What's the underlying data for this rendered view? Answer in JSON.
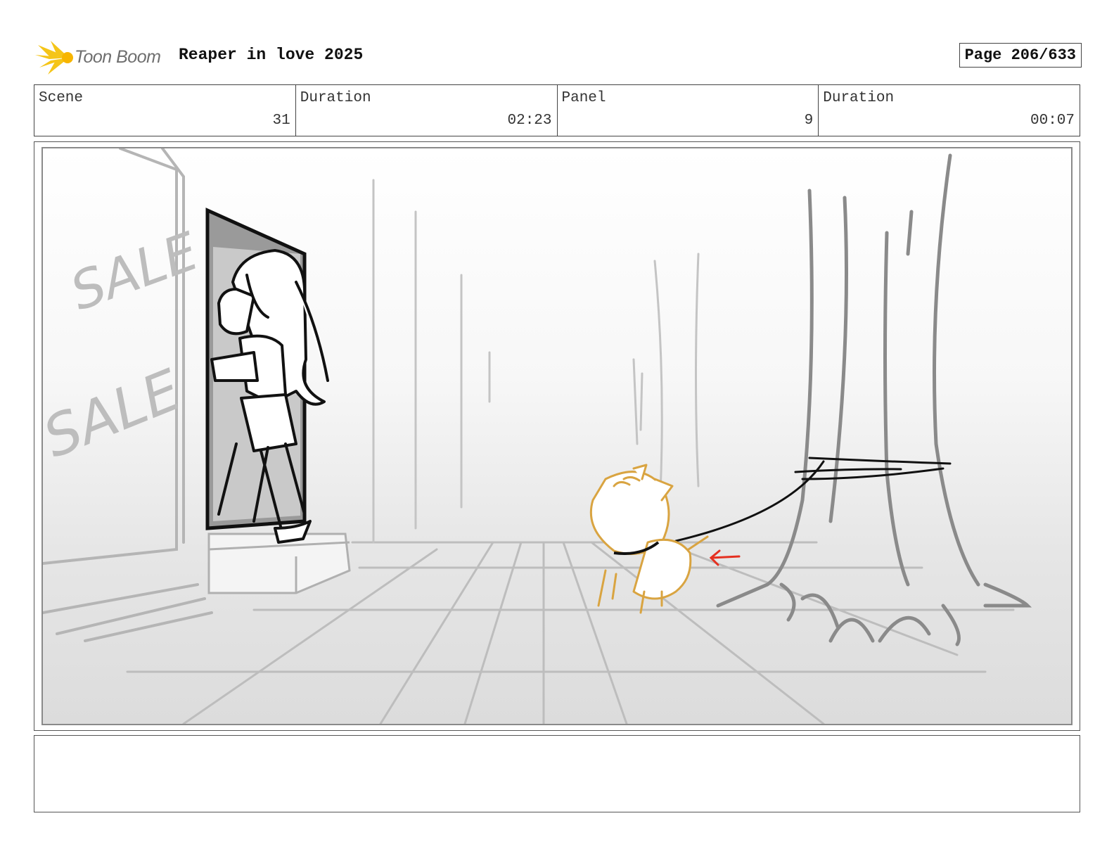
{
  "header": {
    "brand": "Toon Boom",
    "project_title": "Reaper in love 2025",
    "page_label": "Page 206/633"
  },
  "info": {
    "scene_label": "Scene",
    "scene_value": "31",
    "scene_duration_label": "Duration",
    "scene_duration_value": "02:23",
    "panel_label": "Panel",
    "panel_value": "9",
    "panel_duration_label": "Duration",
    "panel_duration_value": "00:07"
  },
  "drawing": {
    "wall_texts": [
      "SALE",
      "SALE"
    ],
    "colors": {
      "logo_accent": "#f5c518",
      "dog_outline": "#d9a441",
      "motion_arrow": "#e53020",
      "ink": "#111111",
      "sketch_gray": "#b8b8b8"
    }
  },
  "notes": {
    "text": ""
  }
}
